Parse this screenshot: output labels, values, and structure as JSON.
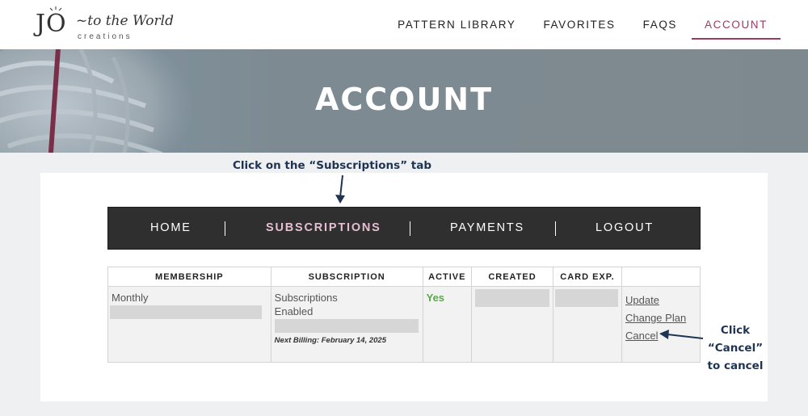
{
  "brand": {
    "name_main": "JO",
    "name_script": "~to the World",
    "name_sub": "creations"
  },
  "nav": {
    "items": [
      {
        "label": "PATTERN LIBRARY"
      },
      {
        "label": "FAVORITES"
      },
      {
        "label": "FAQS"
      },
      {
        "label": "ACCOUNT"
      }
    ],
    "active": "ACCOUNT"
  },
  "hero": {
    "title": "ACCOUNT"
  },
  "annotations": {
    "tab_hint": "Click on the “Subscriptions” tab",
    "cancel_hint_line1": "Click",
    "cancel_hint_line2": "“Cancel”",
    "cancel_hint_line3": "to cancel"
  },
  "account_tabs": {
    "items": [
      {
        "label": "HOME"
      },
      {
        "label": "SUBSCRIPTIONS"
      },
      {
        "label": "PAYMENTS"
      },
      {
        "label": "LOGOUT"
      }
    ],
    "active": "SUBSCRIPTIONS"
  },
  "table": {
    "headers": [
      "MEMBERSHIP",
      "SUBSCRIPTION",
      "ACTIVE",
      "CREATED",
      "CARD EXP.",
      ""
    ],
    "row": {
      "membership": "Monthly",
      "subscription_line1": "Subscriptions",
      "subscription_line2": "Enabled",
      "next_billing": "Next Billing: February 14, 2025",
      "active": "Yes",
      "actions": [
        "Update",
        "Change Plan",
        "Cancel"
      ]
    }
  },
  "colors": {
    "accent": "#9b3a62",
    "annotation": "#1f3352",
    "active_status": "#5aa84a",
    "tab_bar": "#2f2f2f",
    "active_tab": "#e7bfd3"
  }
}
